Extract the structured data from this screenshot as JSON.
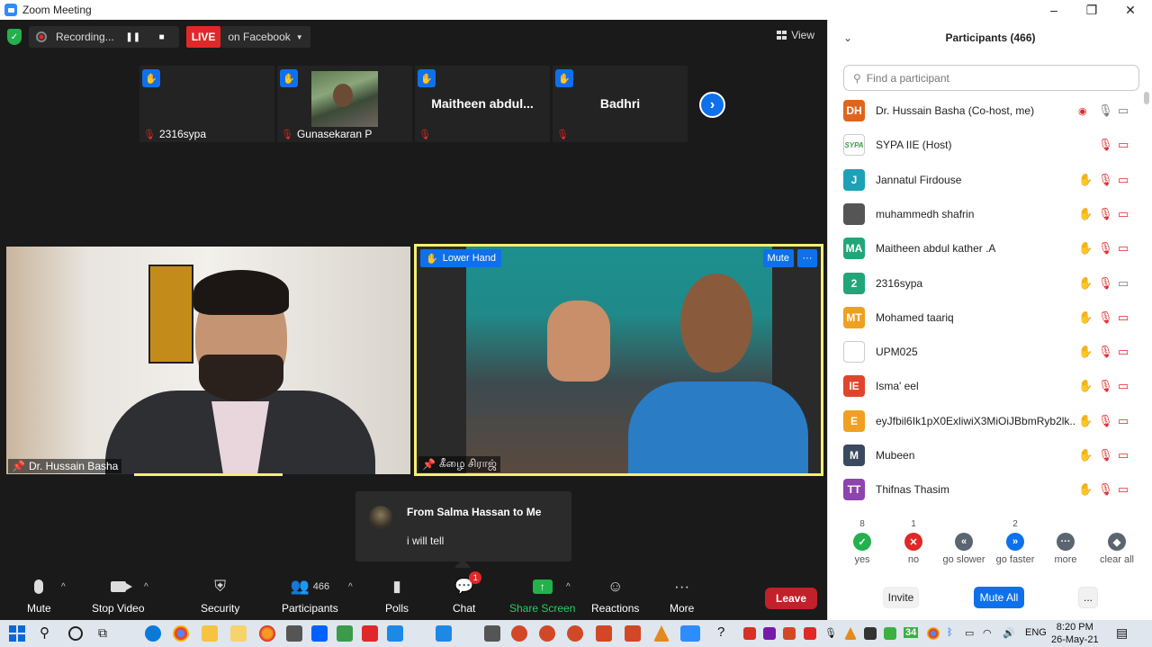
{
  "window": {
    "title": "Zoom Meeting",
    "controls": [
      "–",
      "❐",
      "✕"
    ]
  },
  "meeting": {
    "recording_label": "Recording...",
    "live_badge": "LIVE",
    "live_target": "on Facebook",
    "view_label": "View",
    "thumbnails": [
      {
        "name": "2316sypa",
        "center": "",
        "has_photo": false
      },
      {
        "name": "Gunasekaran P",
        "center": "",
        "has_photo": true
      },
      {
        "name": "",
        "center": "Maitheen  abdul...",
        "has_photo": false
      },
      {
        "name": "",
        "center": "Badhri",
        "has_photo": false
      }
    ],
    "video_left_name": "Dr. Hussain Basha",
    "video_right_name": "கீழை சிராஜ்",
    "lower_hand_label": "Lower Hand",
    "mute_label": "Mute",
    "more_label": "···"
  },
  "chat_popup": {
    "from": "From Salma Hassan to Me",
    "message": "i will tell"
  },
  "toolbar": {
    "mute": "Mute",
    "stop_video": "Stop Video",
    "security": "Security",
    "participants": "Participants",
    "participants_count": "466",
    "polls": "Polls",
    "chat": "Chat",
    "chat_badge": "1",
    "share_screen": "Share Screen",
    "reactions": "Reactions",
    "more": "More",
    "leave": "Leave"
  },
  "panel": {
    "title": "Participants (466)",
    "search_placeholder": "Find a participant",
    "participants": [
      {
        "initials": "DH",
        "color": "#e0651c",
        "name": "Dr. Hussain Basha (Co-host, me)",
        "hand": false,
        "state": "me"
      },
      {
        "initials": "SYPA",
        "color": "#ffffff",
        "name": "SYPA IIE (Host)",
        "hand": false,
        "state": "muted"
      },
      {
        "initials": "J",
        "color": "#1da1b6",
        "name": "Jannatul Firdouse",
        "hand": true,
        "state": "muted"
      },
      {
        "initials": "",
        "color": "#555555",
        "name": "muhammedh shafrin",
        "hand": true,
        "state": "muted"
      },
      {
        "initials": "MA",
        "color": "#21a67a",
        "name": "Maitheen abdul kather .A",
        "hand": true,
        "state": "muted"
      },
      {
        "initials": "2",
        "color": "#21a67a",
        "name": "2316sypa",
        "hand": true,
        "state": "muted-cam-on"
      },
      {
        "initials": "MT",
        "color": "#f0a020",
        "name": "Mohamed taariq",
        "hand": true,
        "state": "muted"
      },
      {
        "initials": "",
        "color": "#ffffff",
        "name": "UPM025",
        "hand": true,
        "state": "muted"
      },
      {
        "initials": "IE",
        "color": "#e0442c",
        "name": "Isma' eel",
        "hand": true,
        "state": "muted"
      },
      {
        "initials": "E",
        "color": "#f0a020",
        "name": "eyJfbil6Ik1pX0ExliwiX3MiOiJBbmRyb2lk...",
        "hand": true,
        "state": "muted"
      },
      {
        "initials": "M",
        "color": "#3a4a5e",
        "name": "Mubeen",
        "hand": true,
        "state": "muted"
      },
      {
        "initials": "TT",
        "color": "#8e44ad",
        "name": "Thifnas Thasim",
        "hand": true,
        "state": "muted"
      }
    ],
    "reactions": [
      {
        "count": "8",
        "label": "yes",
        "color": "#23b14d",
        "glyph": "✓"
      },
      {
        "count": "1",
        "label": "no",
        "color": "#e02828",
        "glyph": "✕"
      },
      {
        "count": "",
        "label": "go slower",
        "color": "#5a6570",
        "glyph": "«"
      },
      {
        "count": "2",
        "label": "go faster",
        "color": "#0e71eb",
        "glyph": "»"
      },
      {
        "count": "",
        "label": "more",
        "color": "#5a6570",
        "glyph": "···"
      },
      {
        "count": "",
        "label": "clear all",
        "color": "#5a6570",
        "glyph": "◆"
      }
    ],
    "invite": "Invite",
    "mute_all": "Mute All",
    "more": "..."
  },
  "taskbar": {
    "time": "8:20 PM",
    "date": "26-May-21",
    "lang": "ENG",
    "badge_34": "34"
  }
}
